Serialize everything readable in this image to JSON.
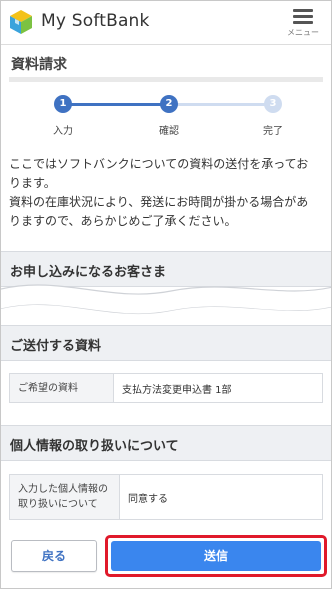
{
  "header": {
    "brand": "My SoftBank",
    "menu_label": "メニュー"
  },
  "page": {
    "title": "資料請求"
  },
  "steps": [
    {
      "num": "1",
      "label": "入力",
      "state": "done"
    },
    {
      "num": "2",
      "label": "確認",
      "state": "current"
    },
    {
      "num": "3",
      "label": "完了",
      "state": "pending"
    }
  ],
  "intro": {
    "line1": "ここではソフトバンクについての資料の送付を承ってお",
    "line2": "ります。",
    "line3": "資料の在庫状況により、発送にお時間が掛かる場合があ",
    "line4": "りますので、あらかじめご了承ください。"
  },
  "sections": {
    "customer": {
      "heading": "お申し込みになるお客さま"
    },
    "documents": {
      "heading": "ご送付する資料",
      "key": "ご希望の資料",
      "value": "支払方法変更申込書 1部"
    },
    "privacy": {
      "heading": "個人情報の取り扱いについて",
      "key_line1": "入力した個人情報の",
      "key_line2": "取り扱いについて",
      "value": "同意する"
    }
  },
  "actions": {
    "back_label": "戻る",
    "send_label": "送信"
  },
  "colors": {
    "accent": "#3f72c2",
    "send_button": "#3a86ee",
    "highlight": "#e0192a"
  }
}
